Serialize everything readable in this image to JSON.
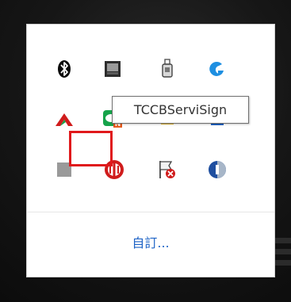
{
  "tray": {
    "icons_row1": [
      {
        "name": "bluetooth-icon",
        "color": "#0a0a0a"
      },
      {
        "name": "monitor-icon",
        "color": "#333333"
      },
      {
        "name": "usb-drive-icon",
        "color": "#555555"
      },
      {
        "name": "logitech-g-icon",
        "color": "#1e8fe1"
      }
    ],
    "icons_row2": [
      {
        "name": "red-arrow-icon",
        "color": "#d01c1c"
      },
      {
        "name": "line-chat-icon",
        "color": "#16a34a"
      },
      {
        "name": "yellow-app-icon",
        "color": "#f0c030"
      },
      {
        "name": "blue-app-icon",
        "color": "#1e63c6"
      }
    ],
    "icons_row3": [
      {
        "name": "gray-square-icon",
        "color": "#9a9a9a"
      },
      {
        "name": "tccb-servisign-icon",
        "color": "#d01c1c"
      },
      {
        "name": "action-center-flag-icon",
        "color": "#d01c1c"
      },
      {
        "name": "blue-circle-app-icon",
        "color": "#1f4fa0"
      }
    ],
    "customize_label": "自訂...",
    "tooltip_text": "TCCBServiSign",
    "highlight_color": "#e0191c"
  }
}
